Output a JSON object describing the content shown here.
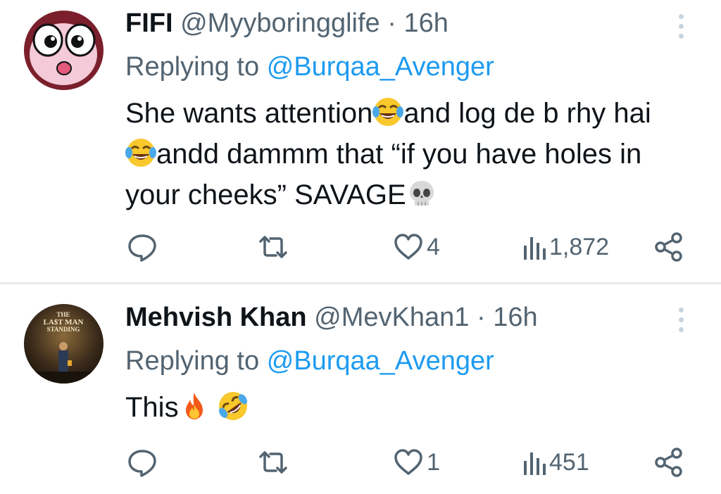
{
  "tweets": [
    {
      "display_name": "FIFI",
      "handle": "@Myyboringglife",
      "separator": "·",
      "time": "16h",
      "reply_prefix": "Replying to",
      "reply_mention": "@Burqaa_Avenger",
      "text_lines": [
        {
          "text": "She wants attention",
          "emoji_after": "face-with-tears-of-joy"
        },
        {
          "text": "and log de b rhy hai",
          "emoji_after": "face-with-tears-of-joy"
        },
        {
          "text": "andd dammm that “if you have holes in your cheeks” SAVAGE",
          "emoji_after": "skull"
        }
      ],
      "part1": "She wants attention",
      "part2": "and log de b rhy hai",
      "part3": "andd dammm that “if you have holes in your cheeks” SAVAGE",
      "likes": "4",
      "views": "1,872",
      "avatar": "cartoon-character-avatar"
    },
    {
      "display_name": "Mehvish Khan",
      "handle": "@MevKhan1",
      "separator": "·",
      "time": "16h",
      "reply_prefix": "Replying to",
      "reply_mention": "@Burqaa_Avenger",
      "part1": "This",
      "emojis": [
        "fire",
        "rolling-on-the-floor-laughing"
      ],
      "likes": "1",
      "views": "451",
      "avatar": "movie-poster-avatar",
      "avatar_text": [
        "THE",
        "LA$T MAN",
        "STANDING"
      ]
    }
  ],
  "icons": {
    "reply": "reply-icon",
    "retweet": "retweet-icon",
    "like": "heart-icon",
    "views": "views-icon",
    "share": "share-icon",
    "more": "more-icon"
  },
  "colors": {
    "text": "#0f1419",
    "secondary": "#536471",
    "link": "#1d9bf0",
    "divider": "#e7e9eb"
  }
}
